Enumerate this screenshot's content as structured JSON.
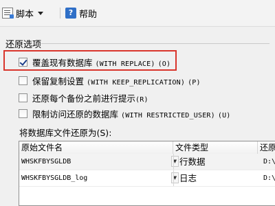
{
  "toolbar": {
    "script_label": "脚本",
    "help_label": "帮助"
  },
  "section": {
    "title": "还原选项"
  },
  "options": [
    {
      "label": "覆盖现有数据库",
      "code": "(WITH REPLACE)",
      "accel": "(O)",
      "checked": true
    },
    {
      "label": "保留复制设置",
      "code": "(WITH KEEP_REPLICATION)",
      "accel": "(P)",
      "checked": false
    },
    {
      "label": "还原每个备份之前进行提示",
      "code": "",
      "accel": "(R)",
      "checked": false
    },
    {
      "label": "限制访问还原的数据库",
      "code": "(WITH RESTRICTED_USER)",
      "accel": "(U)",
      "checked": false
    }
  ],
  "files": {
    "label": "将数据库文件还原为(S):",
    "columns": [
      "原始文件名",
      "文件类型",
      "还原"
    ],
    "rows": [
      {
        "name": "WHSKFBYSGLDB",
        "type": "行数据",
        "path": "D:\\"
      },
      {
        "name": "WHSKFBYSGLDB_log",
        "type": "日志",
        "path": "D:\\"
      }
    ]
  },
  "colors": {
    "highlight": "#d9342b",
    "check": "#1c3f8a"
  }
}
